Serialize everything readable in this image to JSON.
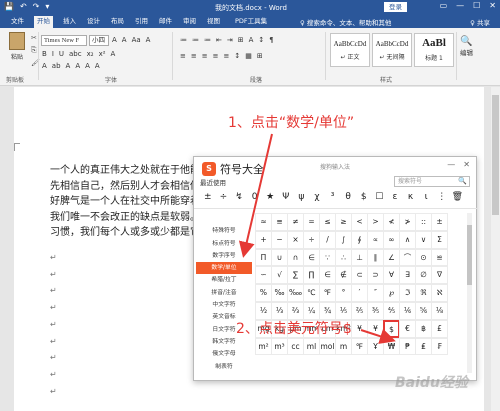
{
  "titlebar": {
    "quick_access": [
      "💾",
      "↶",
      "↷",
      "▾"
    ],
    "doc_title": "我的文档.docx - Word",
    "login": "登录",
    "window_buttons": [
      "▭",
      "—",
      "☐",
      "✕"
    ]
  },
  "tabs": {
    "items": [
      "文件",
      "开始",
      "插入",
      "设计",
      "布局",
      "引用",
      "邮件",
      "审阅",
      "视图",
      "PDF工具集"
    ],
    "active": "开始",
    "search": "♀ 搜索命令、文本、帮助和其他",
    "share": "♀ 共享"
  },
  "ribbon": {
    "paste": "粘贴",
    "clipboard": "剪贴板",
    "font_name": "Times New F",
    "font_size": "小四",
    "font_row1": [
      "A",
      "A",
      "Aa",
      "A"
    ],
    "font_row2": [
      "B",
      "I",
      "U",
      "abc",
      "x₂",
      "x²",
      "A"
    ],
    "font_row3": [
      "A",
      "ab",
      "A",
      "A",
      "A",
      "A"
    ],
    "font_group": "字体",
    "para_row1": [
      "≔",
      "≔",
      "≔",
      "⇤",
      "⇥",
      "⊞",
      "A",
      "↕",
      "¶"
    ],
    "para_row2": [
      "≡",
      "≡",
      "≡",
      "≡",
      "≡",
      "↕",
      "▦",
      "⊞"
    ],
    "para_group": "段落",
    "styles": [
      {
        "preview": "AaBbCcDd",
        "name": "↵ 正文"
      },
      {
        "preview": "AaBbCcDd",
        "name": "↵ 无间隔"
      },
      {
        "preview": "AaBl",
        "name": "标题 1"
      }
    ],
    "styles_group": "样式",
    "edit": "编辑"
  },
  "document": {
    "lines": [
      "一个人的真正伟大之处就在于他能",
      "先相信自己，然后别人才会相信你",
      "好脾气是一个人在社交中所能穿着",
      "我们唯一不会改正的缺点是软弱。",
      "习惯，我们每个人或多或少都是它"
    ],
    "return_mark": "↵"
  },
  "dialog": {
    "title": "符号大全",
    "logo": "S",
    "subtitle": "搜狗输入法",
    "buttons": [
      "—",
      "✕"
    ],
    "recent_label": "最近使用",
    "search_placeholder": "搜索符号",
    "search_icon": "🔍",
    "recent": [
      "±",
      "÷",
      "↯",
      "0",
      "★",
      "Ψ",
      "ψ",
      "χ",
      "³",
      "θ",
      "$",
      "☐",
      "ε",
      "κ",
      "ι",
      "⋮",
      "🗑"
    ],
    "categories": [
      "特殊符号",
      "标点符号",
      "数字序号",
      "数学/单位",
      "希腊/拉丁",
      "拼音/注音",
      "中文字符",
      "英文音标",
      "日文字符",
      "韩文字符",
      "俄文字母",
      "制表符"
    ],
    "active_category": "数学/单位",
    "grid": [
      [
        "≈",
        "≡",
        "≠",
        "=",
        "≤",
        "≥",
        "<",
        ">",
        "≮",
        "≯",
        "::",
        "±"
      ],
      [
        "+",
        "−",
        "×",
        "÷",
        "/",
        "∫",
        "∮",
        "∝",
        "∞",
        "∧",
        "∨",
        "Σ"
      ],
      [
        "Π",
        "∪",
        "∩",
        "∈",
        "∵",
        "∴",
        "⊥",
        "∥",
        "∠",
        "⌒",
        "⊙",
        "≌"
      ],
      [
        "∽",
        "√",
        "∑",
        "∏",
        "∈",
        "∉",
        "⊂",
        "⊃",
        "∀",
        "∃",
        "∅",
        "∇"
      ],
      [
        "%",
        "‰",
        "‱",
        "℃",
        "℉",
        "°",
        "′",
        "″",
        "℘",
        "ℑ",
        "ℜ",
        "ℵ"
      ],
      [
        "½",
        "⅓",
        "⅔",
        "¼",
        "¾",
        "⅕",
        "⅖",
        "⅗",
        "⅘",
        "⅙",
        "⅚",
        "⅛"
      ],
      [
        "mg",
        "kg",
        "μm",
        "mm",
        "cm",
        "km²",
        "¥",
        "¥",
        "$",
        "€",
        "฿",
        "£"
      ],
      [
        "m²",
        "m³",
        "cc",
        "ml",
        "mol",
        "m",
        "℉",
        "Ұ",
        "₩",
        "₱",
        "₤",
        "₣"
      ]
    ],
    "selected": {
      "row": 6,
      "col": 8
    }
  },
  "annotations": {
    "step1": "1、点击“数学/单位”",
    "step2": "2、点击美元符号$"
  },
  "watermark": "Baidu经验",
  "colors": {
    "word_blue": "#2b579a",
    "sogou_orange": "#f25a29",
    "annotation_red": "#e53935"
  }
}
